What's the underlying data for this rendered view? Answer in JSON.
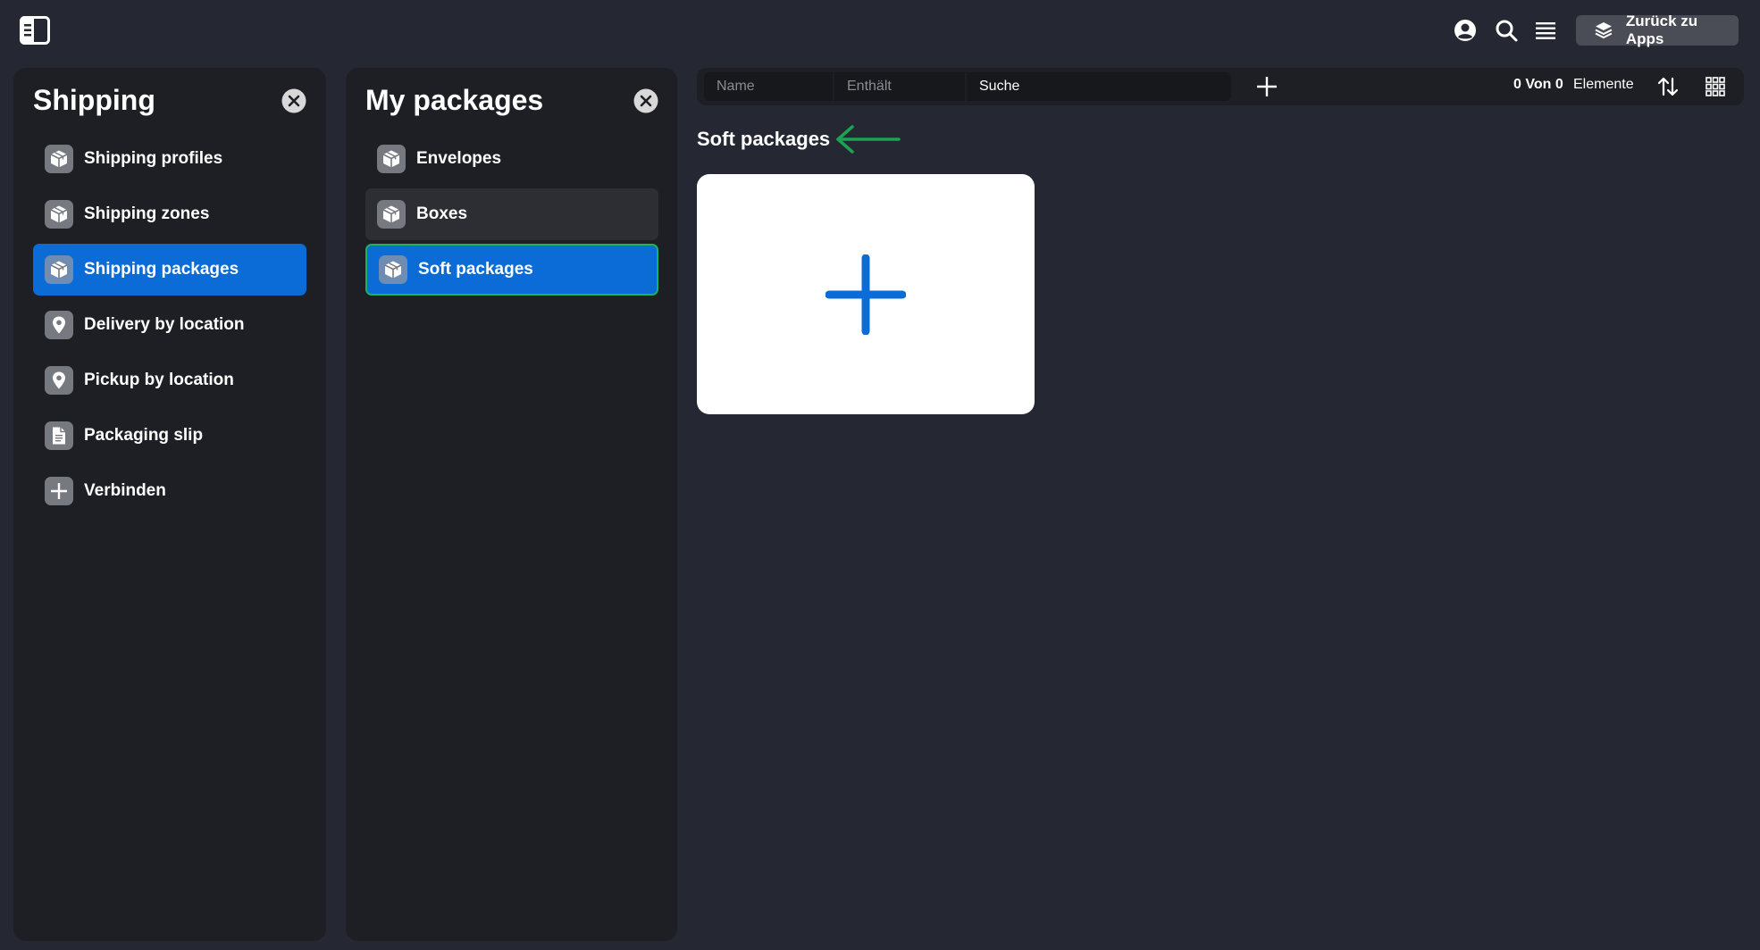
{
  "topbar": {
    "back_label": "Zurück zu Apps",
    "icons": [
      "sidebar-toggle-icon",
      "account-icon",
      "search-icon",
      "menu-icon",
      "layers-icon"
    ]
  },
  "panel_shipping": {
    "title": "Shipping",
    "items": [
      {
        "label": "Shipping profiles",
        "icon": "package-icon"
      },
      {
        "label": "Shipping zones",
        "icon": "package-icon"
      },
      {
        "label": "Shipping packages",
        "icon": "package-icon",
        "state": "active"
      },
      {
        "label": "Delivery by location",
        "icon": "location-pin-icon"
      },
      {
        "label": "Pickup by location",
        "icon": "location-pin-icon"
      },
      {
        "label": "Packaging slip",
        "icon": "document-icon"
      },
      {
        "label": "Verbinden",
        "icon": "plus-icon"
      }
    ]
  },
  "panel_packages": {
    "title": "My packages",
    "items": [
      {
        "label": "Envelopes",
        "icon": "package-icon"
      },
      {
        "label": "Boxes",
        "icon": "package-icon",
        "state": "hover"
      },
      {
        "label": "Soft packages",
        "icon": "package-icon",
        "state": "active"
      }
    ]
  },
  "toolbar": {
    "field_name": "Name",
    "field_operator": "Enthält",
    "search_placeholder": "Suche",
    "count": "0 Von 0",
    "elements_label": "Elemente"
  },
  "main": {
    "section_title": "Soft packages"
  },
  "colors": {
    "accent": "#0c6cd7",
    "focus_ring": "#1bb35f",
    "arrow": "#1aa353",
    "background": "#252833",
    "panel": "#1e1f24"
  }
}
